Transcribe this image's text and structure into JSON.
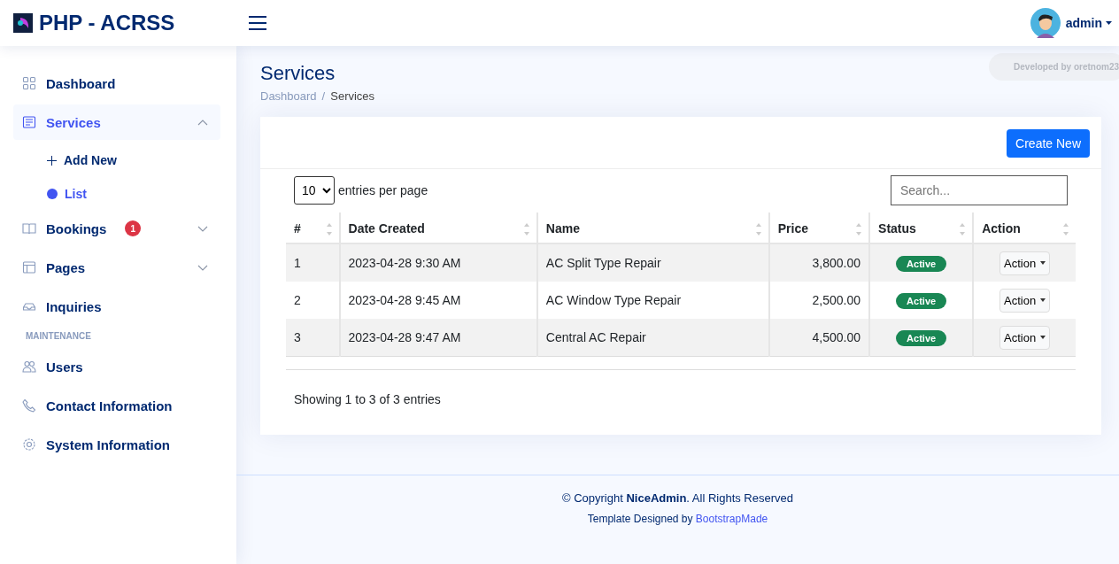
{
  "header": {
    "brand": "PHP - ACRSS",
    "user": "admin"
  },
  "credit": "Developed by oretnom23",
  "sidebar": [
    {
      "kind": "link",
      "label": "Dashboard",
      "selected": false
    },
    {
      "kind": "link",
      "label": "Services",
      "selected": true,
      "expanded": true,
      "children": [
        {
          "label": "Add New",
          "selected": false
        },
        {
          "label": "List",
          "selected": true
        }
      ]
    },
    {
      "kind": "link",
      "label": "Bookings",
      "selected": false,
      "expanded": false,
      "badge": "1"
    },
    {
      "kind": "link",
      "label": "Pages",
      "selected": false,
      "expanded": false
    },
    {
      "kind": "link",
      "label": "Inquiries",
      "selected": false
    },
    {
      "kind": "heading",
      "label": "MAINTENANCE"
    },
    {
      "kind": "link",
      "label": "Users",
      "selected": false
    },
    {
      "kind": "link",
      "label": "Contact Information",
      "selected": false
    },
    {
      "kind": "link",
      "label": "System Information",
      "selected": false
    }
  ],
  "page": {
    "title": "Services",
    "breadcrumb": [
      "Dashboard",
      "Services"
    ],
    "breadcrumb_separator": "/"
  },
  "card": {
    "create_button": "Create New",
    "page_size": "10",
    "entries_label": "entries per page",
    "search": {
      "placeholder": "Search..."
    },
    "table": {
      "columns": [
        "#",
        "Date Created",
        "Name",
        "Price",
        "Status",
        "Action"
      ],
      "rows": [
        {
          "num": "1",
          "date": "2023-04-28 9:30 AM",
          "name": "AC Split Type Repair",
          "price": "3,800.00",
          "status": {
            "label": "Active",
            "kind": "active"
          },
          "action": "Action"
        },
        {
          "num": "2",
          "date": "2023-04-28 9:45 AM",
          "name": "AC Window Type Repair",
          "price": "2,500.00",
          "status": {
            "label": "Active",
            "kind": "active"
          },
          "action": "Action"
        },
        {
          "num": "3",
          "date": "2023-04-28 9:47 AM",
          "name": "Central AC Repair",
          "price": "4,500.00",
          "status": {
            "label": "Active",
            "kind": "active"
          },
          "action": "Action"
        }
      ]
    },
    "info": "Showing 1 to 3 of 3 entries"
  },
  "footer": {
    "copyright": "© Copyright **NiceAdmin**. All Rights Reserved",
    "designed_by": "Template Designed by",
    "designer": "BootstrapMade"
  }
}
